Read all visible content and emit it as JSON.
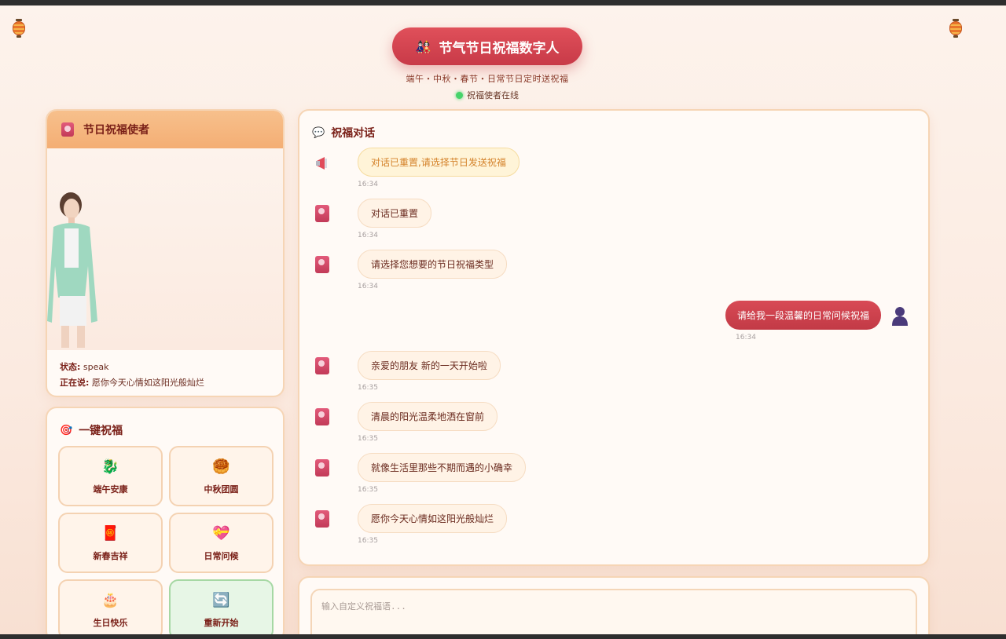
{
  "header": {
    "title_emoji": "🎎",
    "title": "节气节日祝福数字人",
    "subtitle": "端午・中秋・春节・日常节日定时送祝福",
    "status": "祝福使者在线"
  },
  "avatar_panel": {
    "title": "节日祝福使者",
    "state_label": "状态:",
    "state_value": "speak",
    "speaking_label": "正在说:",
    "speaking_value": "愿你今天心情如这阳光般灿烂"
  },
  "quick_panel": {
    "title_emoji": "🎯",
    "title": "一键祝福",
    "buttons": [
      {
        "label": "端午安康",
        "emoji": "🐉"
      },
      {
        "label": "中秋团圆",
        "emoji": "🥮"
      },
      {
        "label": "新春吉祥",
        "emoji": "🧧"
      },
      {
        "label": "日常问候",
        "emoji": "💝"
      },
      {
        "label": "生日快乐",
        "emoji": "🎂"
      },
      {
        "label": "重新开始",
        "emoji": "🔄"
      }
    ]
  },
  "chat": {
    "title_emoji": "💬",
    "title": "祝福对话",
    "messages": [
      {
        "role": "system",
        "text": "对话已重置,请选择节日发送祝福",
        "time": "16:34"
      },
      {
        "role": "bot",
        "text": "对话已重置",
        "time": "16:34"
      },
      {
        "role": "bot",
        "text": "请选择您想要的节日祝福类型",
        "time": "16:34"
      },
      {
        "role": "user",
        "text": "请给我一段温馨的日常问候祝福",
        "time": "16:34"
      },
      {
        "role": "bot",
        "text": "亲爱的朋友 新的一天开始啦",
        "time": "16:35"
      },
      {
        "role": "bot",
        "text": "清晨的阳光温柔地洒在窗前",
        "time": "16:35"
      },
      {
        "role": "bot",
        "text": "就像生活里那些不期而遇的小确幸",
        "time": "16:35"
      },
      {
        "role": "bot",
        "text": "愿你今天心情如这阳光般灿烂",
        "time": "16:35"
      }
    ]
  },
  "input": {
    "placeholder": "输入自定义祝福语..."
  },
  "colors": {
    "accent": "#c83a48",
    "panel_header": "#f4ae74",
    "online": "#46d36a"
  }
}
